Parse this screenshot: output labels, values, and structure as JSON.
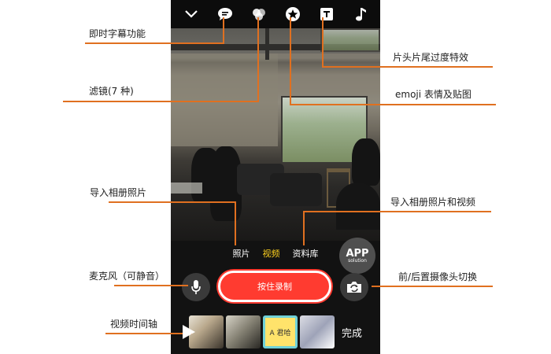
{
  "annotations": {
    "subtitle": "即时字幕功能",
    "filter": "滤镜(7 种)",
    "import_photo": "导入相册照片",
    "mic": "麦克风（可静音）",
    "timeline": "视频时间轴",
    "transition": "片头片尾过度特效",
    "emoji": "emoji 表情及贴图",
    "import_photo_video": "导入相册照片和视频",
    "camera_switch": "前/后置摄像头切换"
  },
  "modes": {
    "photo": "照片",
    "video": "视频",
    "library": "资料库"
  },
  "record_label": "按住录制",
  "done_label": "完成",
  "thumb3_text": "A 君哈",
  "watermark": {
    "main": "APP",
    "sub": "solution"
  },
  "accent_color": "#e07020",
  "icons": [
    "chevron-down-icon",
    "speech-bubble-icon",
    "filter-circles-icon",
    "star-sticker-icon",
    "text-box-icon",
    "music-note-icon",
    "microphone-icon",
    "camera-flip-icon",
    "play-icon"
  ]
}
